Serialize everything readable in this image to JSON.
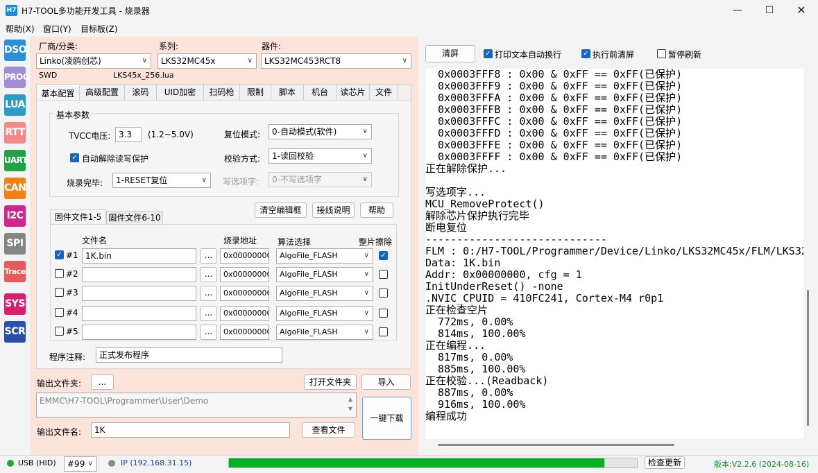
{
  "titlebar": {
    "icon_text": "H7",
    "title": "H7-TOOL多功能开发工具 - 烧录器"
  },
  "menubar": [
    "帮助(X)",
    "窗口(Y)",
    "目标板(Z)"
  ],
  "sidebar": [
    {
      "label": "DSO",
      "color": "#2d8fd6"
    },
    {
      "label": "PROG",
      "color": "#a28ed8"
    },
    {
      "label": "LUA",
      "color": "#2e9bc1"
    },
    {
      "label": "RTT",
      "color": "#f08a8a"
    },
    {
      "label": "UART",
      "color": "#22a046"
    },
    {
      "label": "CAN",
      "color": "#ef8216"
    },
    {
      "label": "I2C",
      "color": "#cc2a8a"
    },
    {
      "label": "SPI",
      "color": "#858585"
    },
    {
      "label": "Trace",
      "color": "#e55a5a"
    },
    {
      "label": "SYS",
      "color": "#d6206e"
    },
    {
      "label": "SCR",
      "color": "#2a4fa8"
    }
  ],
  "device": {
    "vendor_label": "厂商/分类:",
    "vendor_value": "Linko(凌鸥创芯)",
    "series_label": "系列:",
    "series_value": "LKS32MC45x",
    "part_label": "器件:",
    "part_value": "LKS32MC453RCT8",
    "interface": "SWD",
    "lua_file": "LKS45x_256.lua"
  },
  "tabs": [
    "基本配置",
    "高级配置",
    "滚码",
    "UID加密",
    "扫码枪",
    "限制",
    "脚本",
    "机台",
    "读芯片",
    "文件"
  ],
  "basic": {
    "group_title": "基本参数",
    "tvcc_label": "TVCC电压:",
    "tvcc_value": "3.3",
    "tvcc_range": "(1.2~5.0V)",
    "reset_label": "复位模式:",
    "reset_value": "0-自动模式(软件)",
    "auto_unlock_label": "自动解除读写保护",
    "auto_unlock_checked": true,
    "verify_label": "校验方式:",
    "verify_value": "1-读回校验",
    "finish_label": "烧录完毕:",
    "finish_value": "1-RESET复位",
    "option_label": "写选项字:",
    "option_value": "0-不写选项字"
  },
  "file_tabs": [
    "固件文件1-5",
    "固件文件6-10"
  ],
  "file_buttons": {
    "clear": "清空编辑框",
    "wiring": "接线说明",
    "help": "帮助"
  },
  "file_headers": {
    "name": "文件名",
    "addr": "烧录地址",
    "algo": "算法选择",
    "erase": "整片擦除"
  },
  "files": [
    {
      "id": "#1",
      "checked": true,
      "name": "1K.bin",
      "browse": "...",
      "addr": "0x00000000",
      "algo": "AlgoFile_FLASH",
      "erase": true
    },
    {
      "id": "#2",
      "checked": false,
      "name": "",
      "browse": "...",
      "addr": "0x00000000",
      "algo": "AlgoFile_FLASH",
      "erase": false
    },
    {
      "id": "#3",
      "checked": false,
      "name": "",
      "browse": "...",
      "addr": "0x00000000",
      "algo": "AlgoFile_FLASH",
      "erase": false
    },
    {
      "id": "#4",
      "checked": false,
      "name": "",
      "browse": "...",
      "addr": "0x00000000",
      "algo": "AlgoFile_FLASH",
      "erase": false
    },
    {
      "id": "#5",
      "checked": false,
      "name": "",
      "browse": "...",
      "addr": "0x00000000",
      "algo": "AlgoFile_FLASH",
      "erase": false
    }
  ],
  "note": {
    "label": "程序注释:",
    "value": "正式发布程序"
  },
  "output": {
    "folder_label": "输出文件夹:",
    "folder_browse": "...",
    "open_folder": "打开文件夹",
    "import": "导入",
    "path": "EMMC\\H7-TOOL\\Programmer\\User\\Demo",
    "name_label": "输出文件名:",
    "name_value": "1K",
    "view_file": "查看文件",
    "one_click": "一键下载"
  },
  "log_toolbar": {
    "clear": "清屏",
    "wrap_label": "打印文本自动换行",
    "wrap_checked": true,
    "clear_before_label": "执行前清屏",
    "clear_before_checked": true,
    "pause_label": "暂停刷新",
    "pause_checked": false
  },
  "log_lines": [
    "  0x0003FFF8 : 0x00 & 0xFF == 0xFF(已保护)",
    "  0x0003FFF9 : 0x00 & 0xFF == 0xFF(已保护)",
    "  0x0003FFFA : 0x00 & 0xFF == 0xFF(已保护)",
    "  0x0003FFFB : 0x00 & 0xFF == 0xFF(已保护)",
    "  0x0003FFFC : 0x00 & 0xFF == 0xFF(已保护)",
    "  0x0003FFFD : 0x00 & 0xFF == 0xFF(已保护)",
    "  0x0003FFFE : 0x00 & 0xFF == 0xFF(已保护)",
    "  0x0003FFFF : 0x00 & 0xFF == 0xFF(已保护)",
    "正在解除保护...",
    "",
    "写选项字...",
    "MCU_RemoveProtect()",
    "解除芯片保护执行完毕",
    "断电复位",
    "-----------------------------",
    "FLM : 0:/H7-TOOL/Programmer/Device/Linko/LKS32MC45x/FLM/LKS32",
    "Data: 1K.bin",
    "Addr: 0x00000000, cfg = 1",
    "InitUnderReset() -none",
    ".NVIC_CPUID = 410FC241, Cortex-M4 r0p1",
    "正在检查空片",
    "  772ms, 0.00%",
    "  814ms, 100.00%",
    "正在编程...",
    "  817ms, 0.00%",
    "  885ms, 100.00%",
    "正在校验...(Readback)",
    "  887ms, 0.00%",
    "  916ms, 100.00%",
    "编程成功"
  ],
  "status": {
    "usb": "USB (HID)",
    "port": "#99",
    "ip": "IP (192.168.31.15)",
    "progress": 0.92,
    "check_update": "检查更新",
    "version": "版本:V2.2.6 (2024-08-16)"
  }
}
